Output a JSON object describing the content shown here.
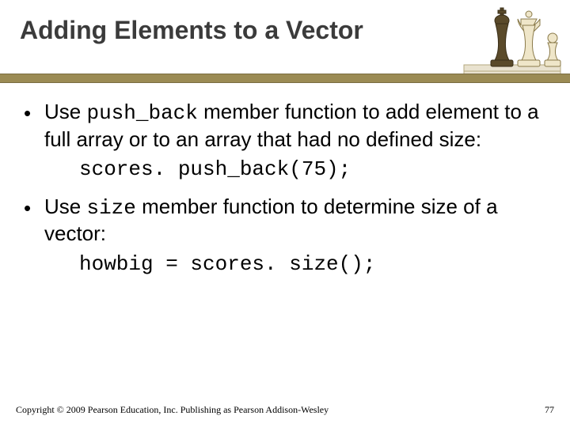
{
  "title": "Adding Elements to a Vector",
  "bullets": [
    {
      "pre": "Use ",
      "code": "push_back",
      "post": " member function to add element to a full array or to an array that had no defined size:",
      "codeblock": "scores. push_back(75);"
    },
    {
      "pre": "Use ",
      "code": "size",
      "post": " member function to determine size of a vector:",
      "codeblock": "howbig = scores. size();"
    }
  ],
  "footer": "Copyright © 2009 Pearson Education, Inc. Publishing as Pearson Addison-Wesley",
  "page": "77",
  "icon": "chess-pieces"
}
